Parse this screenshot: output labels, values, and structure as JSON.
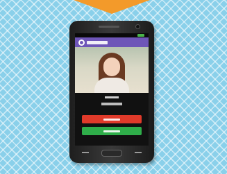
{
  "colors": {
    "background": "#8ad0ea",
    "arrow": "#f39a2a",
    "app_bar": "#6e55b8",
    "end_call_button": "#e03a2a",
    "answer_button": "#2fae4a"
  },
  "icons": [
    "down-arrow-icon",
    "app-logo-icon",
    "signal-icon",
    "menu-key-icon",
    "home-key-icon",
    "back-key-icon"
  ]
}
